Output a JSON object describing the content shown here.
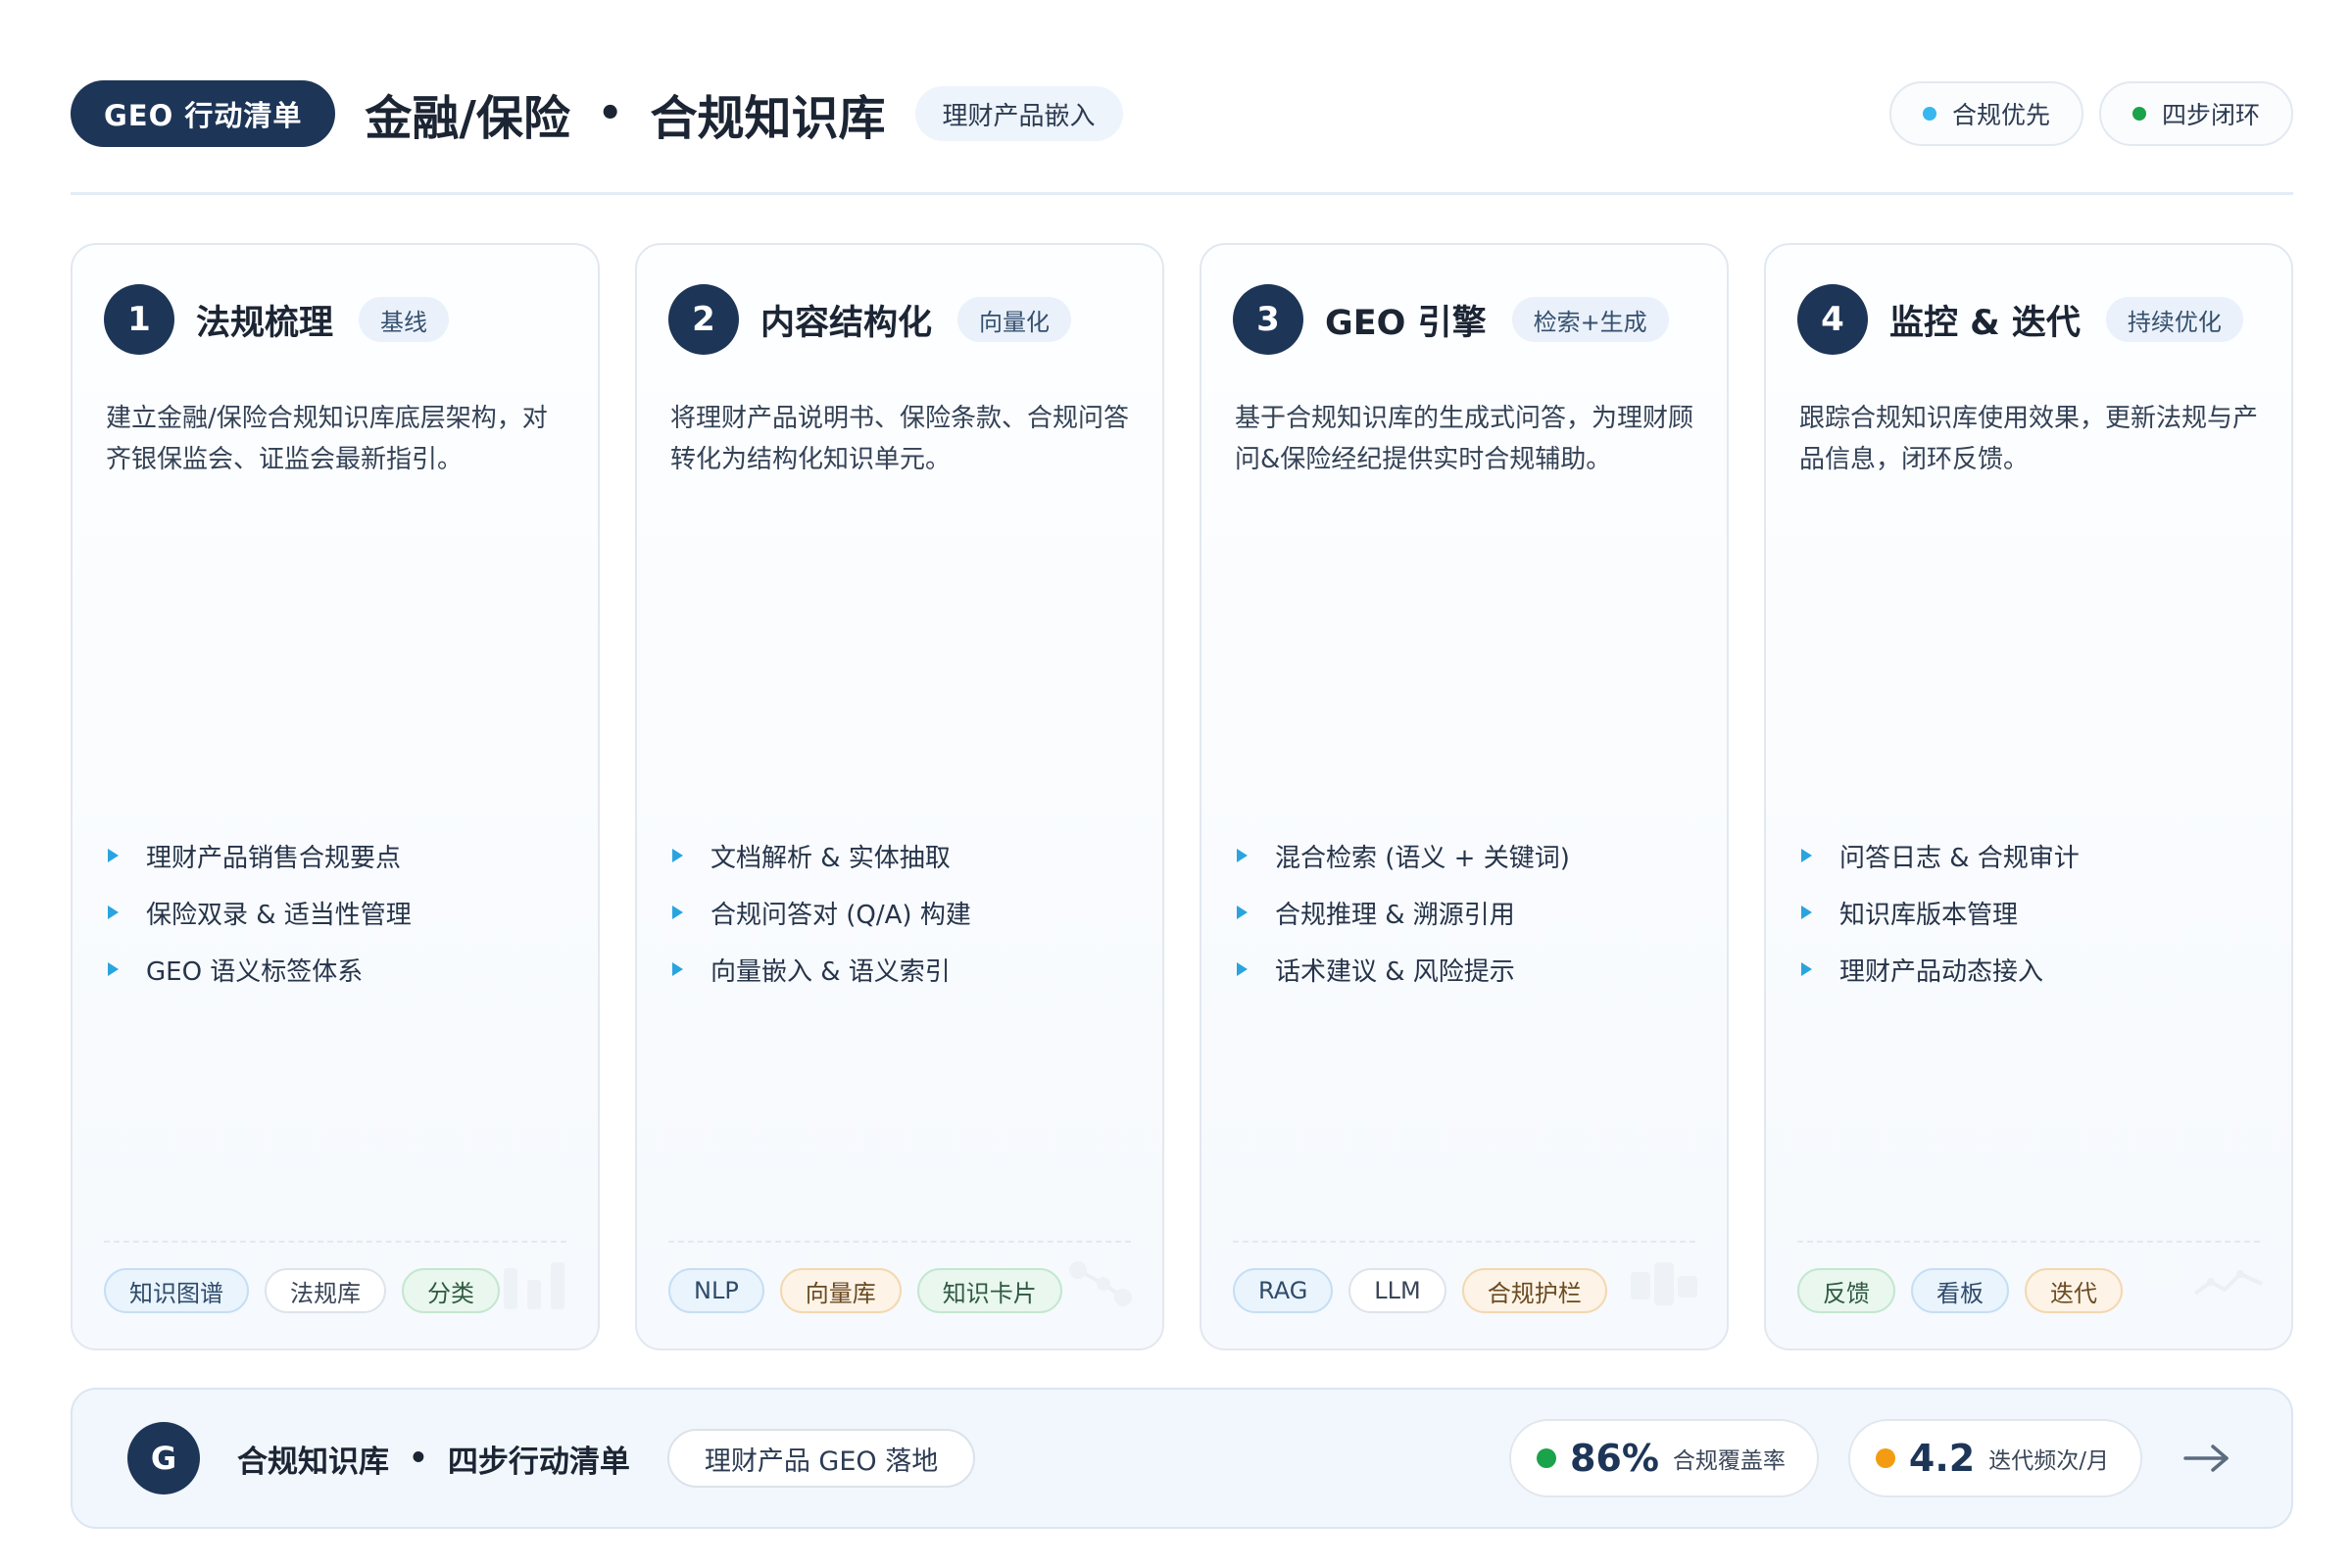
{
  "header": {
    "badge": "GEO 行动清单",
    "title_left": "金融/保险",
    "title_separator": "•",
    "title_right": "合规知识库",
    "subtitle_chip": "理财产品嵌入",
    "status": [
      {
        "label": "合规优先",
        "color": "#38b6f0"
      },
      {
        "label": "四步闭环",
        "color": "#1aa34a"
      }
    ]
  },
  "cards": [
    {
      "number": "1",
      "title": "法规梳理",
      "tag": "基线",
      "description": "建立金融/保险合规知识库底层架构，对齐银保监会、证监会最新指引。",
      "bullets": [
        "理财产品销售合规要点",
        "保险双录 & 适当性管理",
        "GEO 语义标签体系"
      ],
      "chips": [
        {
          "label": "知识图谱",
          "style": "blue"
        },
        {
          "label": "法规库",
          "style": "white"
        },
        {
          "label": "分类",
          "style": "green"
        }
      ],
      "deco_icon": "bar-chart-icon"
    },
    {
      "number": "2",
      "title": "内容结构化",
      "tag": "向量化",
      "description": "将理财产品说明书、保险条款、合规问答转化为结构化知识单元。",
      "bullets": [
        "文档解析 & 实体抽取",
        "合规问答对 (Q/A) 构建",
        "向量嵌入 & 语义索引"
      ],
      "chips": [
        {
          "label": "NLP",
          "style": "blue"
        },
        {
          "label": "向量库",
          "style": "orange"
        },
        {
          "label": "知识卡片",
          "style": "green"
        }
      ],
      "deco_icon": "network-nodes-icon"
    },
    {
      "number": "3",
      "title": "GEO 引擎",
      "tag": "检索+生成",
      "description": "基于合规知识库的生成式问答，为理财顾问&保险经纪提供实时合规辅助。",
      "bullets": [
        "混合检索 (语义 + 关键词)",
        "合规推理 & 溯源引用",
        "话术建议 & 风险提示"
      ],
      "chips": [
        {
          "label": "RAG",
          "style": "blue"
        },
        {
          "label": "LLM",
          "style": "white"
        },
        {
          "label": "合规护栏",
          "style": "orange"
        }
      ],
      "deco_icon": "blocks-icon"
    },
    {
      "number": "4",
      "title": "监控 & 迭代",
      "tag": "持续优化",
      "description": "跟踪合规知识库使用效果，更新法规与产品信息，闭环反馈。",
      "bullets": [
        "问答日志 & 合规审计",
        "知识库版本管理",
        "理财产品动态接入"
      ],
      "chips": [
        {
          "label": "反馈",
          "style": "green"
        },
        {
          "label": "看板",
          "style": "blue"
        },
        {
          "label": "迭代",
          "style": "orange"
        }
      ],
      "deco_icon": "line-trend-icon"
    }
  ],
  "footer": {
    "badge": "G",
    "title_left": "合规知识库",
    "title_separator": "•",
    "title_right": "四步行动清单",
    "chip": "理财产品 GEO 落地",
    "metrics": [
      {
        "value": "86%",
        "label": "合规覆盖率",
        "color": "#1aa34a"
      },
      {
        "value": "4.2",
        "label": "迭代频次/月",
        "color": "#f39c12"
      }
    ]
  }
}
